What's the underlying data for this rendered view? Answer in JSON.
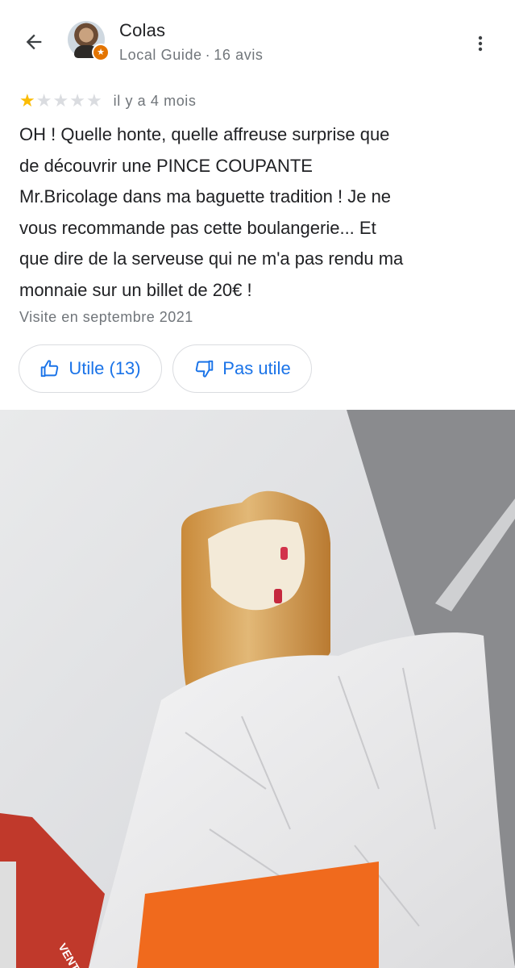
{
  "header": {
    "back_icon": "arrow-left-icon",
    "user_name": "Colas",
    "user_role": "Local Guide",
    "separator": "·",
    "review_count": "16 avis",
    "more_icon": "more-vert-icon",
    "badge_icon": "local-guide-star-icon"
  },
  "review": {
    "rating": 1,
    "rating_max": 5,
    "time_ago": "il y a 4 mois",
    "text": "OH ! Quelle honte, quelle affreuse surprise que\nde découvrir une PINCE COUPANTE\nMr.Bricolage dans ma baguette tradition ! Je ne\nvous recommande pas cette boulangerie...  Et\nque dire de la serveuse qui ne m'a pas rendu ma\nmonnaie sur un billet de 20€ !",
    "visit": "Visite en septembre 2021"
  },
  "actions": {
    "useful_label": "Utile (13)",
    "useful_icon": "thumb-up-icon",
    "not_useful_label": "Pas utile",
    "not_useful_icon": "thumb-down-icon"
  },
  "photo": {
    "bag_text": "VENTE"
  },
  "colors": {
    "accent": "#1a73e8",
    "star": "#fbbc04",
    "badge": "#e37400",
    "text": "#202124",
    "secondary_text": "#70757a"
  }
}
